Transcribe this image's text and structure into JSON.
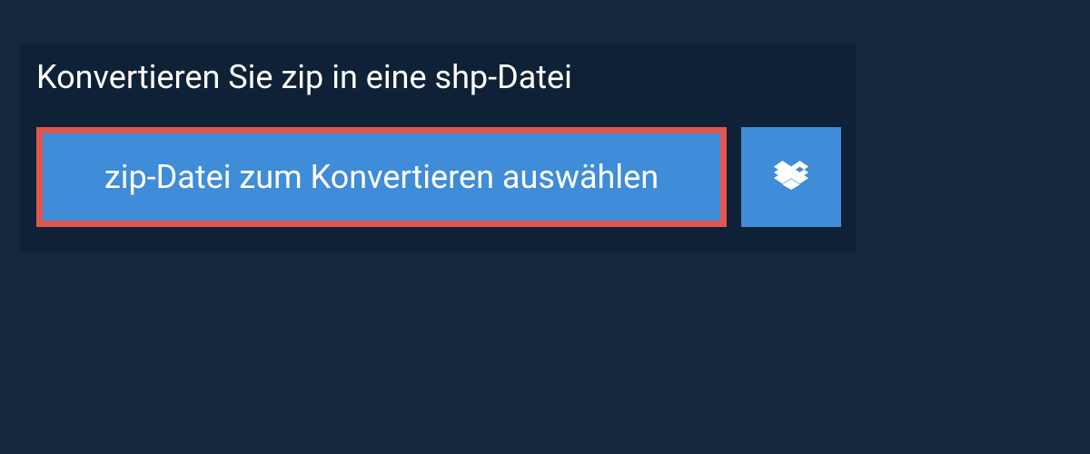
{
  "panel": {
    "title": "Konvertieren Sie zip in eine shp-Datei",
    "select_button_label": "zip-Datei zum Konvertieren auswählen"
  }
}
